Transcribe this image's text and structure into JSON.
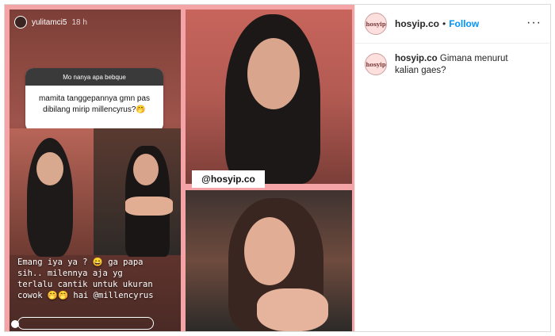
{
  "story": {
    "username": "yulitamci5",
    "time": "18 h",
    "question_header": "Mo nanya apa bebque",
    "question_answer": "mamita tanggepannya gmn pas dibilang mirip millencyrus?",
    "answer_emoji": "🤭",
    "caption_line1": "Emang iya ya ? 😄 ga papa",
    "caption_line2": "sih.. milennya aja yg",
    "caption_line3": "terlalu cantik untuk ukuran",
    "caption_line4": "cowok 🤭🤭 hai @millencyrus"
  },
  "watermark": "@hosyip.co",
  "post": {
    "username": "hosyip.co",
    "separator": "•",
    "follow_label": "Follow",
    "more_label": "···",
    "avatar_text": "hosyip",
    "caption": "Gimana menurut kalian gaes?"
  }
}
